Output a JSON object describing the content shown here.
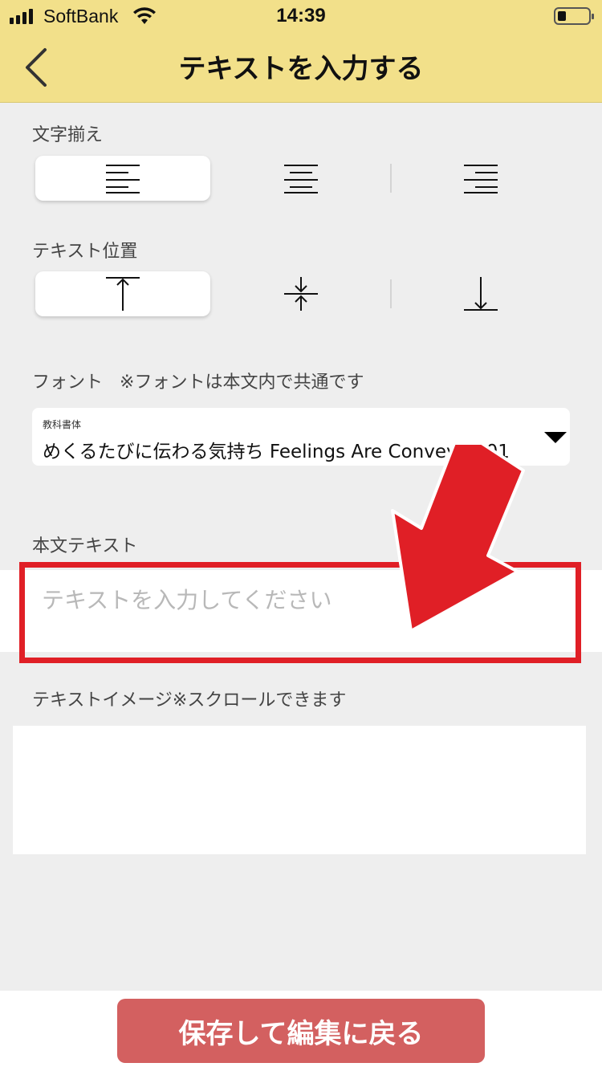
{
  "status_bar": {
    "carrier": "SoftBank",
    "time": "14:39"
  },
  "header": {
    "title": "テキストを入力する",
    "background": "#f2e08a"
  },
  "alignment": {
    "label": "文字揃え",
    "options": [
      "align-left-icon",
      "align-center-icon",
      "align-right-icon"
    ],
    "selected": "left"
  },
  "text_position": {
    "label": "テキスト位置",
    "options": [
      "align-top-icon",
      "align-middle-icon",
      "align-bottom-icon"
    ],
    "selected": "top"
  },
  "font": {
    "label": "フォント",
    "note": "※フォントは本文内で共通です",
    "category": "教科書体",
    "selected": "めくるたびに伝わる気持ち Feelings Are Conveyed 01"
  },
  "body_text": {
    "label": "本文テキスト",
    "value": "",
    "placeholder": "テキストを入力してください"
  },
  "preview": {
    "label": "テキストイメージ※スクロールできます"
  },
  "footer": {
    "save_label": "保存して編集に戻る",
    "button_color": "#d36060"
  },
  "annotation": {
    "color": "#e01f26"
  }
}
